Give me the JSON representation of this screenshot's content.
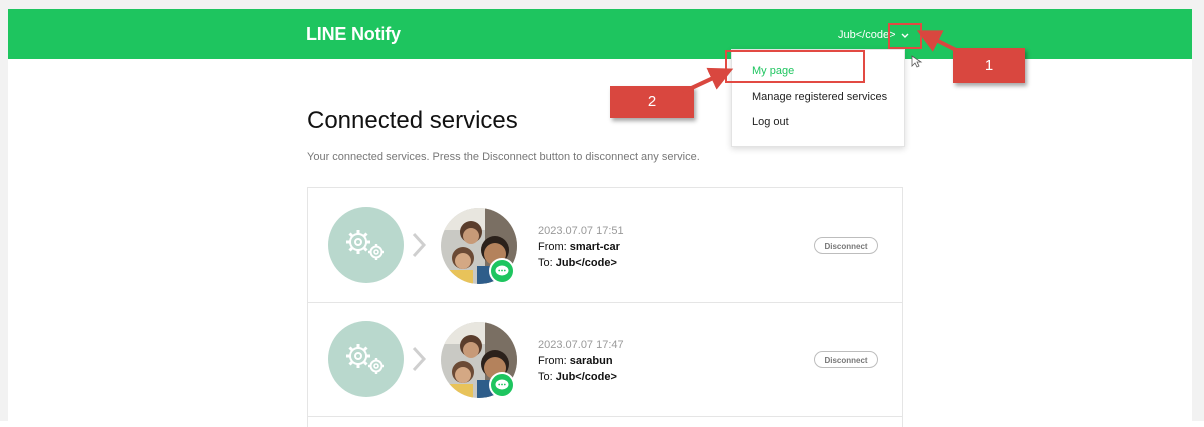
{
  "header": {
    "logo": "LINE Notify",
    "user_name": "Jub</code>"
  },
  "dropdown": {
    "items": [
      {
        "label": "My page"
      },
      {
        "label": "Manage registered services"
      },
      {
        "label": "Log out"
      }
    ]
  },
  "callouts": {
    "one": "1",
    "two": "2"
  },
  "main": {
    "title": "Connected services",
    "description": "Your connected services. Press the Disconnect button to disconnect any service.",
    "from_label": "From: ",
    "to_label": "To: ",
    "disconnect_label": "Disconnect",
    "services": [
      {
        "date": "2023.07.07 17:51",
        "from": "smart-car",
        "to": "Jub</code>"
      },
      {
        "date": "2023.07.07 17:47",
        "from": "sarabun",
        "to": "Jub</code>"
      }
    ]
  },
  "icons": {
    "service": "gear-icon",
    "arrow": "chevron-right-icon",
    "badge": "line-chat-icon",
    "toggle": "chevron-down-icon"
  },
  "colors": {
    "brand": "#1ec55f",
    "annotation": "#d9473f",
    "service_circle": "#b9d8cd"
  }
}
